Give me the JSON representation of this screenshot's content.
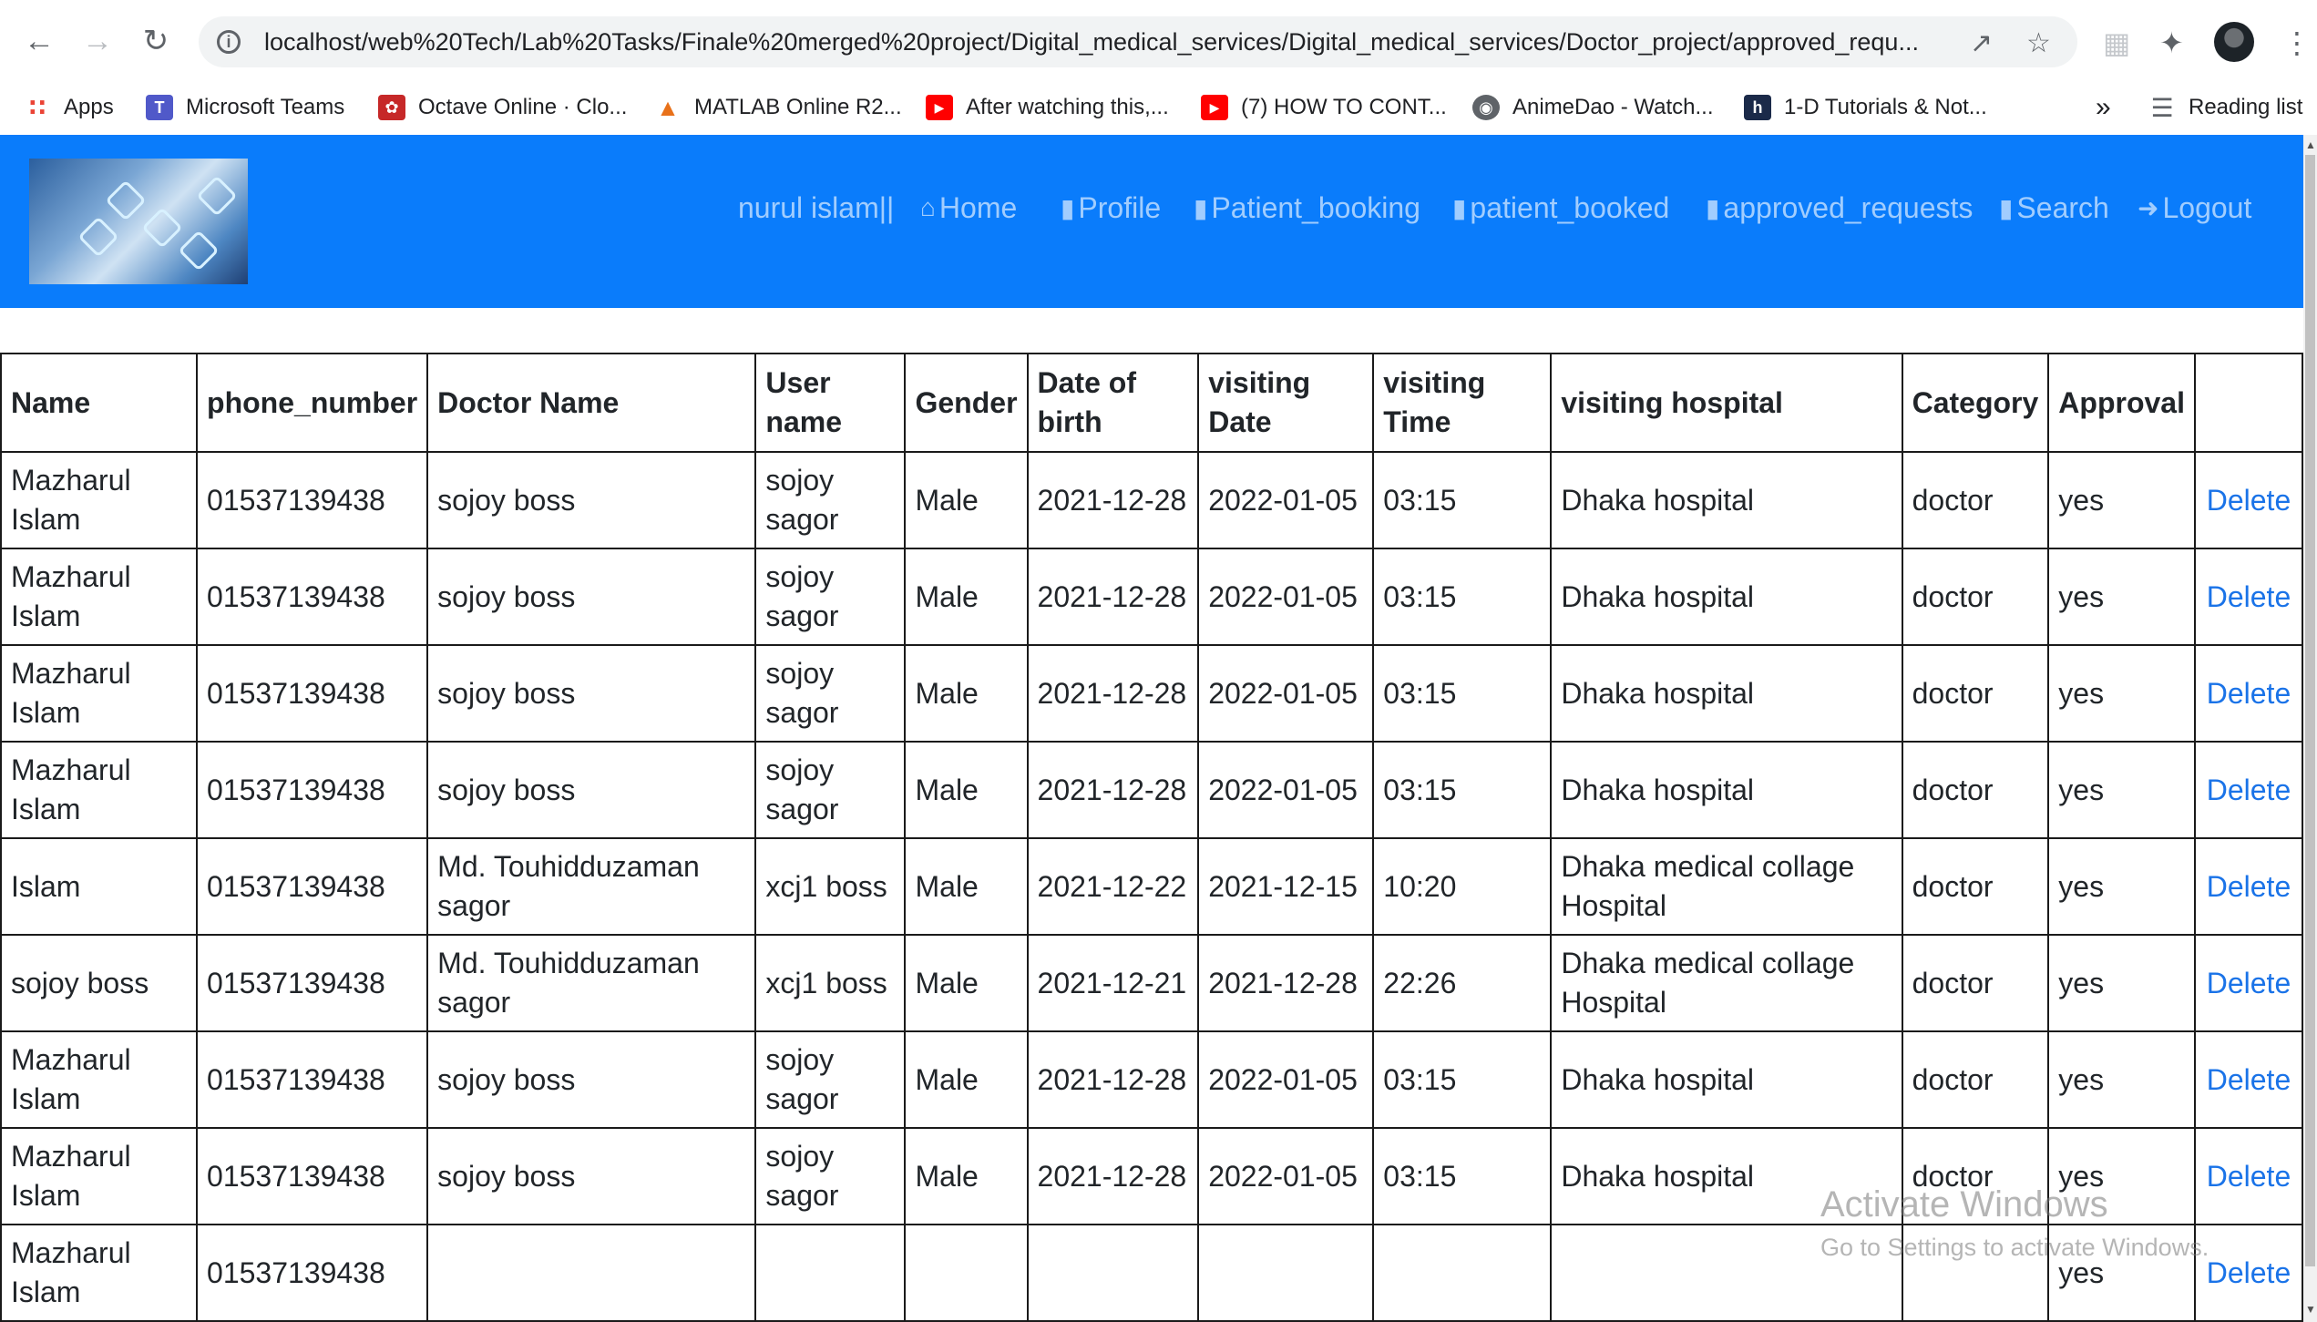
{
  "browser": {
    "url": "localhost/web%20Tech/Lab%20Tasks/Finale%20merged%20project/Digital_medical_services/Digital_medical_services/Doctor_project/approved_requ...",
    "bookmarks": [
      {
        "label": "Apps",
        "icon": "apps-grid-icon",
        "color": "#ea4335"
      },
      {
        "label": "Microsoft Teams",
        "icon": "teams-icon",
        "color": "#5059c9"
      },
      {
        "label": "Octave Online · Clo...",
        "icon": "octave-icon",
        "color": "#c62828"
      },
      {
        "label": "MATLAB Online R2...",
        "icon": "matlab-icon",
        "color": "#e8711a"
      },
      {
        "label": "After watching this,...",
        "icon": "youtube-icon",
        "color": "#ff0000"
      },
      {
        "label": "(7) HOW TO CONT...",
        "icon": "youtube-icon",
        "color": "#ff0000"
      },
      {
        "label": "AnimeDao - Watch...",
        "icon": "globe-icon",
        "color": "#5f6368"
      },
      {
        "label": "1-D Tutorials & Not...",
        "icon": "h-icon",
        "color": "#1b2a49"
      }
    ],
    "more_bookmarks": "»",
    "reading_list": "Reading list"
  },
  "header": {
    "user": "nurul islam||",
    "nav": [
      {
        "label": "Home",
        "icon": "home-icon"
      },
      {
        "label": "Profile",
        "icon": "id-badge-icon"
      },
      {
        "label": "Patient_booking",
        "icon": "id-badge-icon"
      },
      {
        "label": "patient_booked",
        "icon": "id-badge-icon"
      },
      {
        "label": "approved_requests",
        "icon": "id-badge-icon"
      },
      {
        "label": "Search",
        "icon": "id-badge-icon"
      },
      {
        "label": "Logout",
        "icon": "logout-icon"
      }
    ],
    "accent": "#0a7cfb"
  },
  "table": {
    "columns": [
      "Name",
      "phone_number",
      "Doctor Name",
      "User name",
      "Gender",
      "Date of birth",
      "visiting Date",
      "visiting Time",
      "visiting hospital",
      "Category",
      "Approval",
      ""
    ],
    "rows": [
      [
        "Mazharul Islam",
        "01537139438",
        "sojoy boss",
        "sojoy sagor",
        "Male",
        "2021-12-28",
        "2022-01-05",
        "03:15",
        "Dhaka hospital",
        "doctor",
        "yes",
        "Delete"
      ],
      [
        "Mazharul Islam",
        "01537139438",
        "sojoy boss",
        "sojoy sagor",
        "Male",
        "2021-12-28",
        "2022-01-05",
        "03:15",
        "Dhaka hospital",
        "doctor",
        "yes",
        "Delete"
      ],
      [
        "Mazharul Islam",
        "01537139438",
        "sojoy boss",
        "sojoy sagor",
        "Male",
        "2021-12-28",
        "2022-01-05",
        "03:15",
        "Dhaka hospital",
        "doctor",
        "yes",
        "Delete"
      ],
      [
        "Mazharul Islam",
        "01537139438",
        "sojoy boss",
        "sojoy sagor",
        "Male",
        "2021-12-28",
        "2022-01-05",
        "03:15",
        "Dhaka hospital",
        "doctor",
        "yes",
        "Delete"
      ],
      [
        "Islam",
        "01537139438",
        "Md. Touhidduzaman sagor",
        "xcj1 boss",
        "Male",
        "2021-12-22",
        "2021-12-15",
        "10:20",
        "Dhaka medical collage Hospital",
        "doctor",
        "yes",
        "Delete"
      ],
      [
        "sojoy boss",
        "01537139438",
        "Md. Touhidduzaman sagor",
        "xcj1 boss",
        "Male",
        "2021-12-21",
        "2021-12-28",
        "22:26",
        "Dhaka medical collage Hospital",
        "doctor",
        "yes",
        "Delete"
      ],
      [
        "Mazharul Islam",
        "01537139438",
        "sojoy boss",
        "sojoy sagor",
        "Male",
        "2021-12-28",
        "2022-01-05",
        "03:15",
        "Dhaka hospital",
        "doctor",
        "yes",
        "Delete"
      ],
      [
        "Mazharul Islam",
        "01537139438",
        "sojoy boss",
        "sojoy sagor",
        "Male",
        "2021-12-28",
        "2022-01-05",
        "03:15",
        "Dhaka hospital",
        "doctor",
        "yes",
        "Delete"
      ],
      [
        "Mazharul Islam",
        "01537139438",
        "",
        "",
        "",
        "",
        "",
        "",
        "",
        "",
        "yes",
        "Delete"
      ]
    ]
  },
  "watermark": {
    "title": "Activate Windows",
    "subtitle": "Go to Settings to activate Windows."
  }
}
